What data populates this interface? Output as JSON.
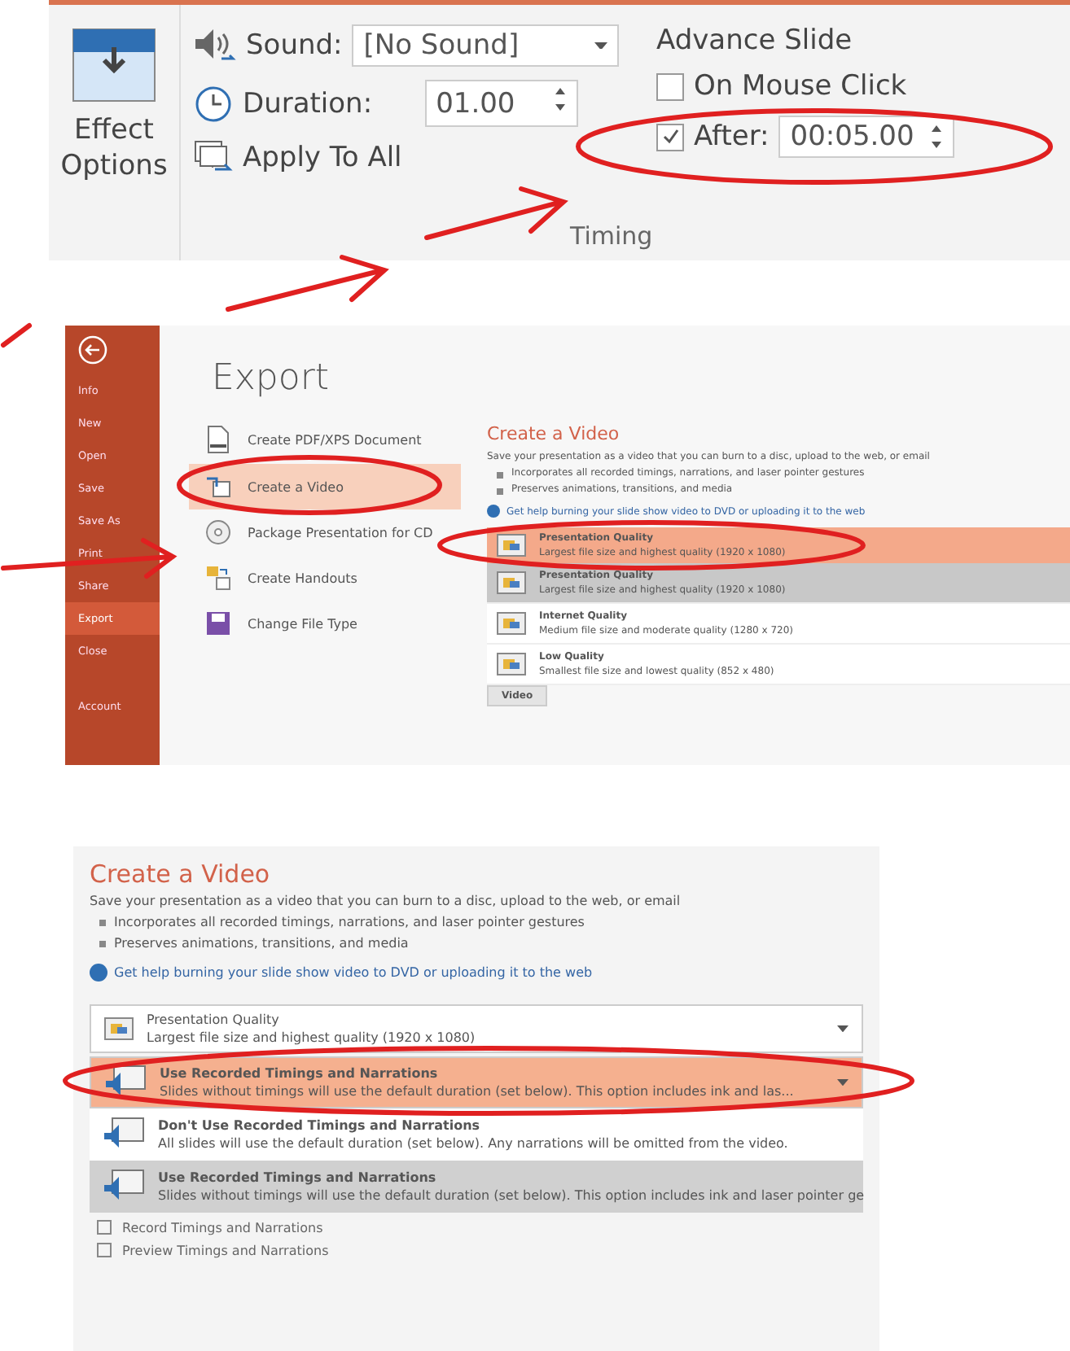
{
  "ribbon": {
    "effect_options": "Effect Options",
    "sound_label": "Sound:",
    "sound_value": "[No Sound]",
    "duration_label": "Duration:",
    "duration_value": "01.00",
    "apply_all": "Apply To All",
    "group_label": "Timing",
    "advance_title": "Advance Slide",
    "on_mouse_click": {
      "label": "On Mouse Click",
      "checked": false
    },
    "after": {
      "label": "After:",
      "checked": true,
      "value": "00:05.00"
    }
  },
  "backstage": {
    "nav": [
      {
        "label": "Info",
        "selected": false
      },
      {
        "label": "New",
        "selected": false
      },
      {
        "label": "Open",
        "selected": false
      },
      {
        "label": "Save",
        "selected": false
      },
      {
        "label": "Save As",
        "selected": false
      },
      {
        "label": "Print",
        "selected": false
      },
      {
        "label": "Share",
        "selected": false
      },
      {
        "label": "Export",
        "selected": true
      },
      {
        "label": "Close",
        "selected": false
      },
      {
        "label": "Account",
        "selected": false
      }
    ],
    "title": "Export",
    "options": [
      {
        "label": "Create PDF/XPS Document",
        "kind": "pdf",
        "selected": false
      },
      {
        "label": "Create a Video",
        "kind": "video",
        "selected": true
      },
      {
        "label": "Package Presentation for CD",
        "kind": "cd",
        "selected": false
      },
      {
        "label": "Create Handouts",
        "kind": "handouts",
        "selected": false
      },
      {
        "label": "Change File Type",
        "kind": "filetype",
        "selected": false
      }
    ],
    "pane": {
      "title": "Create a Video",
      "description": "Save your presentation as a video that you can burn to a disc, upload to the web, or email",
      "bullets": [
        "Incorporates all recorded timings, narrations, and laser pointer gestures",
        "Preserves animations, transitions, and media"
      ],
      "help_link": "Get help burning your slide show video to DVD or uploading it to the web",
      "dropdown": {
        "title": "Presentation Quality",
        "subtitle": "Largest file size and highest quality (1920 x 1080)"
      },
      "qualities": [
        {
          "title": "Presentation Quality",
          "subtitle": "Largest file size and highest quality (1920 x 1080)",
          "selected": true
        },
        {
          "title": "Internet Quality",
          "subtitle": "Medium file size and moderate quality (1280 x 720)",
          "selected": false
        },
        {
          "title": "Low Quality",
          "subtitle": "Smallest file size and lowest quality (852 x 480)",
          "selected": false
        }
      ],
      "footer_tab": "Video"
    }
  },
  "create_video": {
    "title": "Create a Video",
    "description": "Save your presentation as a video that you can burn to a disc, upload to the web, or email",
    "bullets": [
      "Incorporates all recorded timings, narrations, and laser pointer gestures",
      "Preserves animations, transitions, and media"
    ],
    "help_link": "Get help burning your slide show video to DVD or uploading it to the web",
    "quality_dropdown": {
      "title": "Presentation Quality",
      "subtitle": "Largest file size and highest quality (1920 x 1080)"
    },
    "timing_dropdown": {
      "title": "Use Recorded Timings and Narrations",
      "subtitle": "Slides without timings will use the default duration (set below). This option includes ink and las..."
    },
    "timing_options": [
      {
        "title": "Don't Use Recorded Timings and Narrations",
        "subtitle": "All slides will use the default duration (set below). Any narrations will be omitted from the video.",
        "selected": false
      },
      {
        "title": "Use Recorded Timings and Narrations",
        "subtitle": "Slides without timings will use the default duration (set below). This option includes ink and laser pointer ge",
        "selected": true
      }
    ],
    "actions": [
      "Record Timings and Narrations",
      "Preview Timings and Narrations"
    ]
  }
}
